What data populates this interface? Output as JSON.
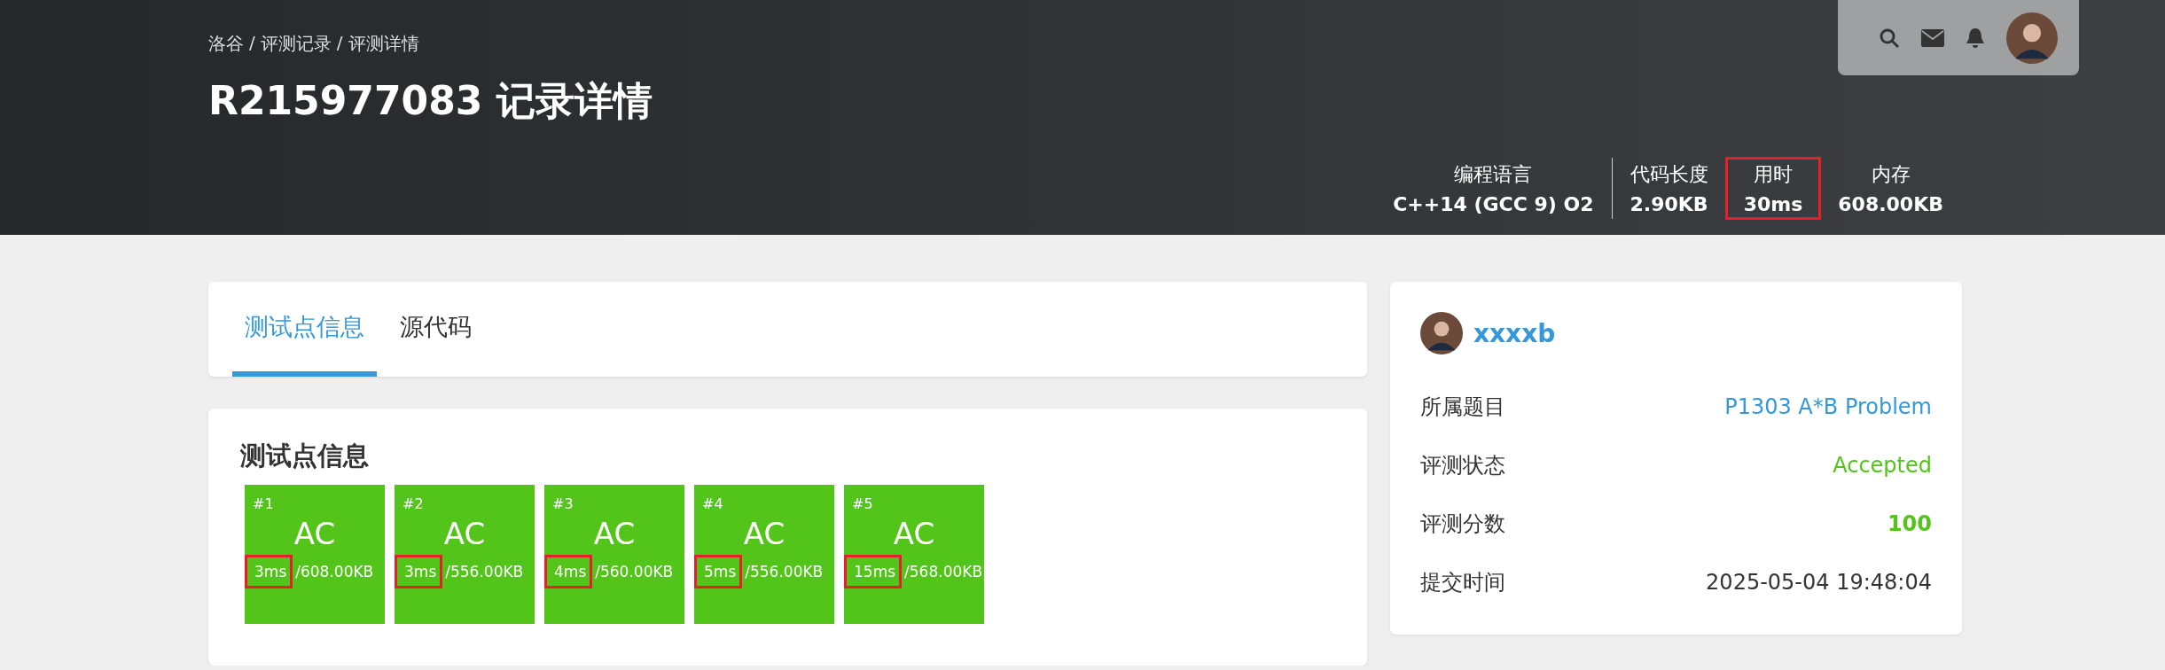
{
  "breadcrumb": {
    "items": [
      "洛谷",
      "评测记录",
      "评测详情"
    ],
    "separator": "/"
  },
  "title": "R215977083 记录详情",
  "stats": [
    {
      "label": "编程语言",
      "value": "C++14 (GCC 9) O2",
      "highlighted": false
    },
    {
      "label": "代码长度",
      "value": "2.90KB",
      "highlighted": false
    },
    {
      "label": "用时",
      "value": "30ms",
      "highlighted": true
    },
    {
      "label": "内存",
      "value": "608.00KB",
      "highlighted": false
    }
  ],
  "tabs": [
    {
      "label": "测试点信息",
      "selected": true
    },
    {
      "label": "源代码",
      "selected": false
    }
  ],
  "cases_title": "测试点信息",
  "cases": [
    {
      "index": "#1",
      "status": "AC",
      "time": "3ms",
      "separator": "/",
      "memory": "608.00KB",
      "time_highlighted": true
    },
    {
      "index": "#2",
      "status": "AC",
      "time": "3ms",
      "separator": "/",
      "memory": "556.00KB",
      "time_highlighted": true
    },
    {
      "index": "#3",
      "status": "AC",
      "time": "4ms",
      "separator": "/",
      "memory": "560.00KB",
      "time_highlighted": true
    },
    {
      "index": "#4",
      "status": "AC",
      "time": "5ms",
      "separator": "/",
      "memory": "556.00KB",
      "time_highlighted": true
    },
    {
      "index": "#5",
      "status": "AC",
      "time": "15ms",
      "separator": "/",
      "memory": "568.00KB",
      "time_highlighted": true
    }
  ],
  "user": {
    "name": "xxxxb"
  },
  "details": [
    {
      "label": "所属题目",
      "value": "P1303 A*B Problem",
      "kind": "link"
    },
    {
      "label": "评测状态",
      "value": "Accepted",
      "kind": "status"
    },
    {
      "label": "评测分数",
      "value": "100",
      "kind": "score"
    },
    {
      "label": "提交时间",
      "value": "2025-05-04 19:48:04",
      "kind": "plain"
    }
  ]
}
